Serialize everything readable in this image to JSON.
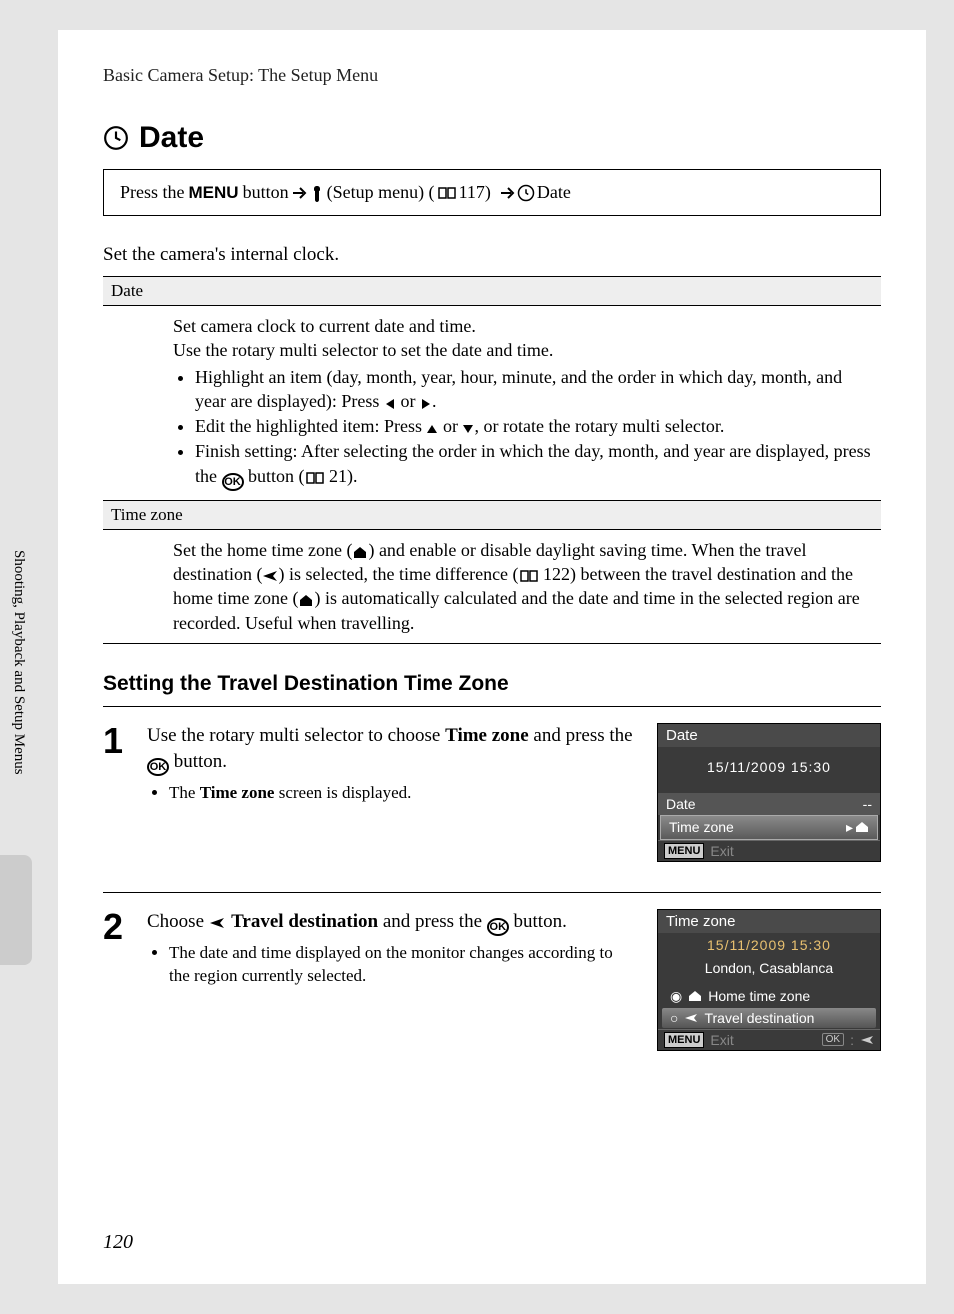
{
  "chapter": "Basic Camera Setup: The Setup Menu",
  "title": "Date",
  "path": {
    "press": "Press the ",
    "menu": "MENU",
    "button": " button",
    "setup_label": " (Setup menu) (",
    "ref1": " 117)",
    "date": " Date"
  },
  "intro": "Set the camera's internal clock.",
  "tbl": {
    "date_hdr": "Date",
    "date_p1": "Set camera clock to current date and time.",
    "date_p2": "Use the rotary multi selector to set the date and time.",
    "date_li1a": "Highlight an item (day, month, year, hour, minute, and the order in which day, month, and year are displayed): Press ",
    "date_li1b": " or ",
    "date_li1c": ".",
    "date_li2a": "Edit the highlighted item: Press ",
    "date_li2b": " or ",
    "date_li2c": ", or rotate the rotary multi selector.",
    "date_li3a": "Finish setting: After selecting the order in which the day, month, and year are displayed, press the ",
    "date_li3b": " button (",
    "date_li3c": " 21).",
    "tz_hdr": "Time zone",
    "tz_p1a": "Set the home time zone (",
    "tz_p1b": ") and enable or disable daylight saving time. When the travel destination (",
    "tz_p1c": ") is selected, the time difference (",
    "tz_p1d": " 122) between the travel destination and the home time zone (",
    "tz_p1e": ") is automatically calculated and the date and time in the selected region are recorded. Useful when travelling."
  },
  "subhead": "Setting the Travel Destination Time Zone",
  "steps": {
    "s1": {
      "num": "1",
      "main_a": "Use the rotary multi selector to choose ",
      "main_b": "Time zone",
      "main_c": " and press the ",
      "main_d": " button.",
      "bullet_a": "The ",
      "bullet_b": "Time zone",
      "bullet_c": " screen is displayed."
    },
    "s2": {
      "num": "2",
      "main_a": "Choose ",
      "main_b": " Travel destination",
      "main_c": " and press the ",
      "main_d": " button.",
      "bullet": "The date and time displayed on the monitor changes according to the region currently selected."
    }
  },
  "lcd1": {
    "title": "Date",
    "datetime": "15/11/2009  15:30",
    "row1": "Date",
    "row1_val": "--",
    "row2": "Time zone",
    "exit_menu": "MENU",
    "exit": "Exit"
  },
  "lcd2": {
    "title": "Time zone",
    "datetime": "15/11/2009 15:30",
    "region": "London, Casablanca",
    "opt1": "Home time zone",
    "opt2": "Travel destination",
    "exit_menu": "MENU",
    "exit": "Exit",
    "ok": "OK",
    "colon": ":"
  },
  "side": "Shooting, Playback and Setup Menus",
  "page_num": "120"
}
